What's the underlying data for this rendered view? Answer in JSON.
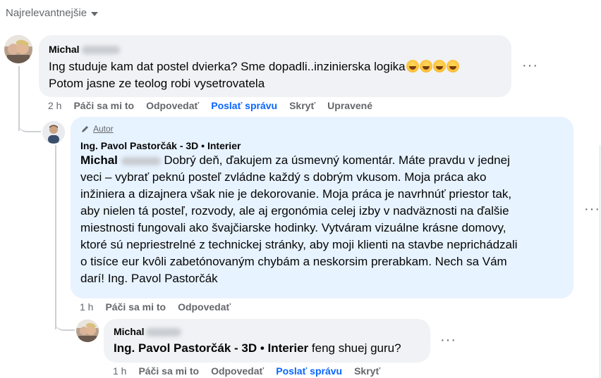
{
  "sort": {
    "label": "Najrelevantnejšie"
  },
  "c1": {
    "author": "Michal",
    "line1": "Ing studuje kam dat postel dvierka? Sme dopadli..inzinierska logika",
    "line2": "Potom jasne ze teolog robi vysetrovatela",
    "time": "2 h",
    "like": "Páči sa mi to",
    "reply": "Odpovedať",
    "message": "Poslať správu",
    "hide": "Skryť",
    "edited": "Upravené",
    "more": "···"
  },
  "c2": {
    "badge": "Autor",
    "author": "Ing. Pavol Pastorčák - 3D • Interier",
    "mention": "Michal",
    "lines": [
      "Dobrý deň, ďakujem za úsmevný komentár. Máte pravdu v jednej",
      "veci – vybrať peknú posteľ zvládne každý s dobrým vkusom. Moja práca ako",
      "inžiniera a dizajnera však nie je dekorovanie. Moja práca je navrhnúť priestor tak,",
      "aby nielen tá posteľ, rozvody, ale aj ergonómia celej izby v nadväznosti na ďalšie",
      "miestnosti fungovali ako švajčiarske hodinky. Vytváram vizuálne krásne domovy,",
      "ktoré sú nepriestrelné z technickej stránky, aby moji klienti na stavbe neprichádzali",
      "o tisíce eur kvôli zabetónovaným chybám a neskorsim prerabkam. Nech sa Vám",
      "darí! Ing. Pavol Pastorčák"
    ],
    "time": "1 h",
    "like": "Páči sa mi to",
    "reply": "Odpovedať",
    "more": "···"
  },
  "c3": {
    "author": "Michal",
    "mention": "Ing. Pavol Pastorčák - 3D • Interier",
    "text": "feng shuej guru?",
    "time": "1 h",
    "like": "Páči sa mi to",
    "reply": "Odpovedať",
    "message": "Poslať správu",
    "hide": "Skryť",
    "more": "···"
  }
}
